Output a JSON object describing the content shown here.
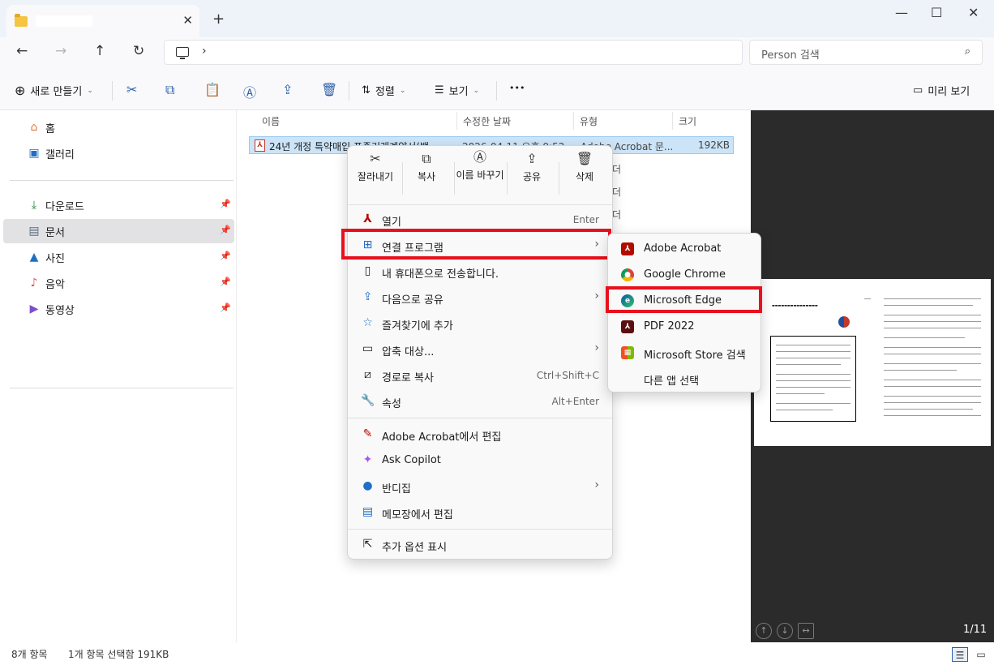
{
  "window": {
    "tab_title": "",
    "new_tab": "+",
    "minimize": "—",
    "maximize": "☐",
    "close": "✕"
  },
  "search": {
    "placeholder": "Person 검색"
  },
  "toolbar": {
    "new_label": "새로 만들기",
    "sort_label": "정렬",
    "view_label": "보기",
    "more_label": "•••",
    "preview_label": "미리 보기"
  },
  "sidebar": {
    "items": [
      {
        "label": "홈",
        "icon": "home-icon"
      },
      {
        "label": "갤러리",
        "icon": "gallery-icon"
      },
      {
        "label": "다운로드",
        "icon": "download-icon",
        "pinned": true
      },
      {
        "label": "문서",
        "icon": "document-icon",
        "pinned": true,
        "selected": true
      },
      {
        "label": "사진",
        "icon": "pictures-icon",
        "pinned": true
      },
      {
        "label": "음악",
        "icon": "music-icon",
        "pinned": true
      },
      {
        "label": "동영상",
        "icon": "video-icon",
        "pinned": true
      }
    ]
  },
  "filelist": {
    "columns": [
      "이름",
      "수정한 날짜",
      "유형",
      "크기"
    ],
    "rows": [
      {
        "name": "24년 개정 특약매입 표준거래계약서(백",
        "date": "2026-04-11 오후 9:52",
        "type": "Adobe Acrobat 문...",
        "size": "192KB"
      }
    ],
    "ghost_types": [
      "더",
      "더",
      "더"
    ]
  },
  "context_menu": {
    "quick_actions": [
      "잘라내기",
      "복사",
      "이름 바꾸기",
      "공유",
      "삭제"
    ],
    "items": [
      {
        "label": "열기",
        "shortcut": "Enter",
        "icon": "acrobat-icon"
      },
      {
        "label": "연결 프로그램",
        "submenu": true,
        "icon": "open-with-icon",
        "highlighted": true
      },
      {
        "label": "내 휴대폰으로 전송합니다.",
        "icon": "phone-icon"
      },
      {
        "label": "다음으로 공유",
        "submenu": true,
        "icon": "share-icon"
      },
      {
        "label": "즐겨찾기에 추가",
        "icon": "star-icon"
      },
      {
        "label": "압축 대상...",
        "submenu": true,
        "icon": "zip-icon"
      },
      {
        "label": "경로로 복사",
        "shortcut": "Ctrl+Shift+C",
        "icon": "path-icon"
      },
      {
        "label": "속성",
        "shortcut": "Alt+Enter",
        "icon": "wrench-icon"
      },
      {
        "label": "Adobe Acrobat에서 편집",
        "icon": "acrobat-edit-icon"
      },
      {
        "label": "Ask Copilot",
        "icon": "copilot-icon"
      },
      {
        "label": "반디집",
        "submenu": true,
        "icon": "bandizip-icon"
      },
      {
        "label": "메모장에서 편집",
        "icon": "notepad-icon"
      },
      {
        "label": "추가 옵션 표시",
        "icon": "more-options-icon"
      }
    ]
  },
  "submenu": {
    "items": [
      {
        "label": "Adobe Acrobat",
        "icon": "acrobat-icon",
        "color": "#b30b00"
      },
      {
        "label": "Google Chrome",
        "icon": "chrome-icon"
      },
      {
        "label": "Microsoft Edge",
        "icon": "edge-icon",
        "highlighted": true
      },
      {
        "label": "PDF 2022",
        "icon": "pdf2022-icon",
        "color": "#5a1010"
      },
      {
        "label": "Microsoft Store 검색",
        "icon": "store-icon"
      },
      {
        "label": "다른 앱 선택",
        "icon": ""
      }
    ]
  },
  "preview": {
    "page_count": "1/11"
  },
  "status": {
    "item_count": "8개 항목",
    "selection": "1개 항목 선택함 191KB"
  },
  "colors": {
    "highlight_red": "#e8101d",
    "selection_blue": "#cce4f7",
    "accent": "#2b5ea8"
  }
}
